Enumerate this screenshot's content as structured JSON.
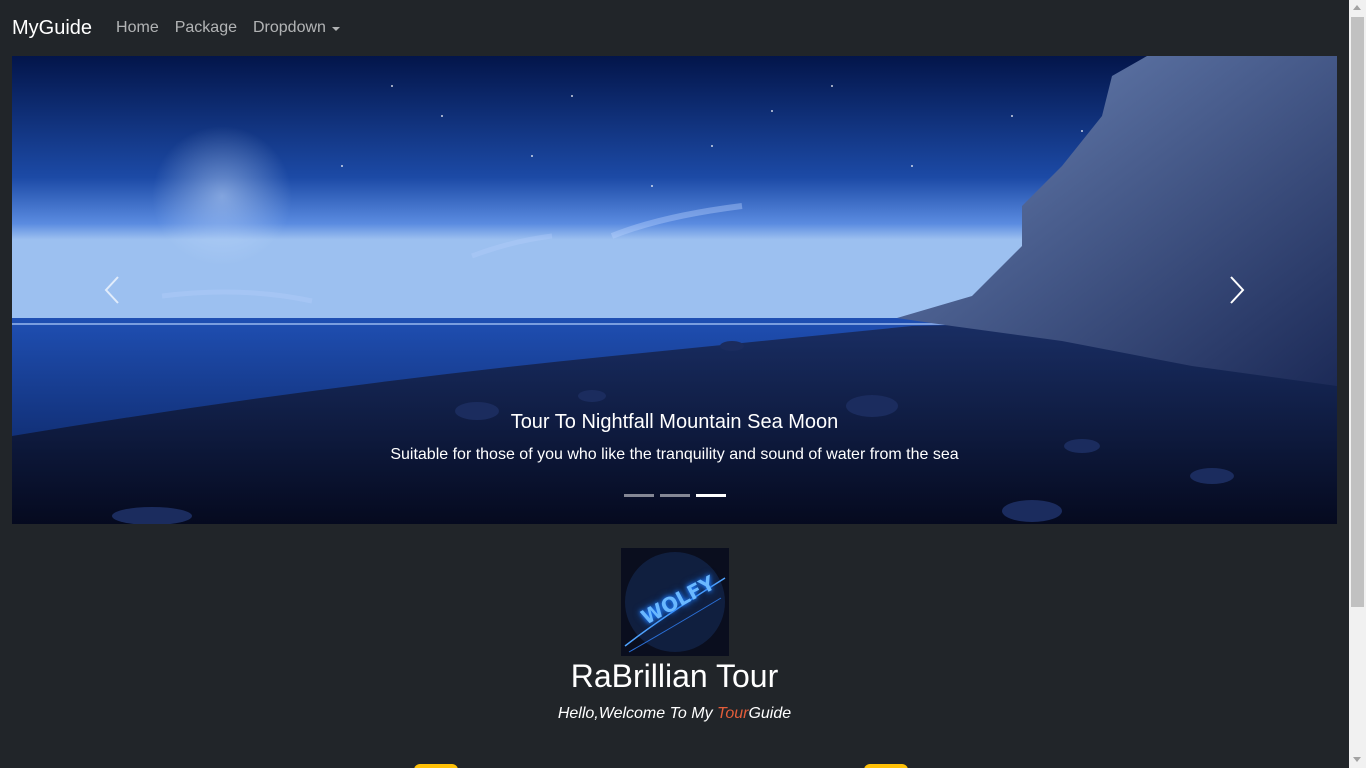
{
  "navbar": {
    "brand": "MyGuide",
    "items": [
      {
        "label": "Home"
      },
      {
        "label": "Package"
      },
      {
        "label": "Dropdown"
      }
    ]
  },
  "carousel": {
    "caption_title": "Tour To Nightfall Mountain Sea Moon",
    "caption_text": "Suitable for those of you who like the tranquility and sound of water from the sea",
    "slide_count": 3,
    "active_index": 2
  },
  "intro": {
    "logo_text": "WOLFY",
    "title": "RaBrillian Tour",
    "welcome_prefix": "Hello,Welcome To My ",
    "welcome_accent": "Tour",
    "welcome_suffix": "Guide"
  },
  "colors": {
    "background": "#212529",
    "accent": "#e35d3a",
    "badge": "#ffc107"
  }
}
